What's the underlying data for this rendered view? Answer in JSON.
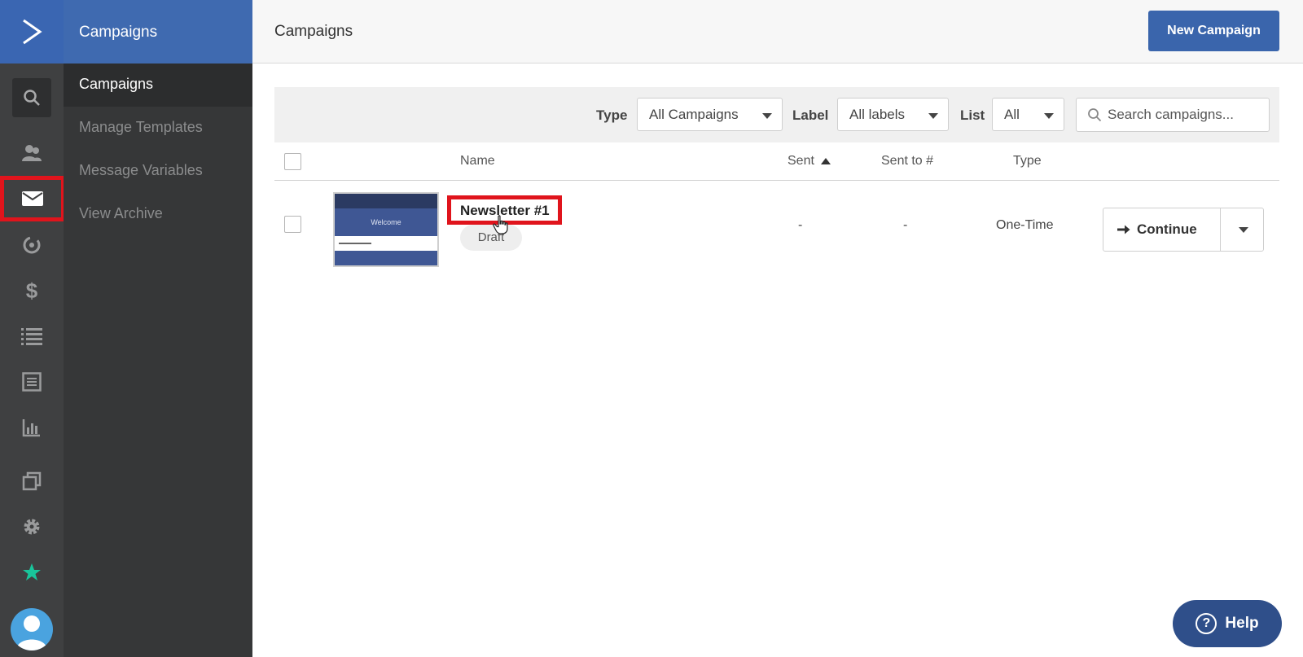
{
  "sidebar": {
    "section_title": "Campaigns",
    "items": [
      {
        "label": "Campaigns"
      },
      {
        "label": "Manage Templates"
      },
      {
        "label": "Message Variables"
      },
      {
        "label": "View Archive"
      }
    ],
    "rail_icons": [
      "logo-icon",
      "search-icon",
      "contacts-icon",
      "email-icon",
      "automation-icon",
      "deals-icon",
      "lists-icon",
      "forms-icon",
      "reports-icon",
      "pages-icon",
      "settings-icon",
      "star-icon",
      "avatar-icon"
    ]
  },
  "header": {
    "title": "Campaigns",
    "new_button": "New Campaign"
  },
  "filters": {
    "type_label": "Type",
    "type_value": "All Campaigns",
    "label_label": "Label",
    "label_value": "All labels",
    "list_label": "List",
    "list_value": "All",
    "search_placeholder": "Search campaigns..."
  },
  "table": {
    "columns": [
      "Name",
      "Sent",
      "Sent to #",
      "Type"
    ],
    "rows": [
      {
        "thumbnail_text": "Welcome",
        "name": "Newsletter #1",
        "status": "Draft",
        "sent": "-",
        "sent_to": "-",
        "type": "One-Time",
        "action": "Continue"
      }
    ]
  },
  "help": {
    "label": "Help",
    "glyph": "?"
  },
  "colors": {
    "brand": "#3a65ac",
    "rail": "#3f4041",
    "subnav": "#363738",
    "highlight": "#e0141c",
    "star": "#19c59b"
  }
}
